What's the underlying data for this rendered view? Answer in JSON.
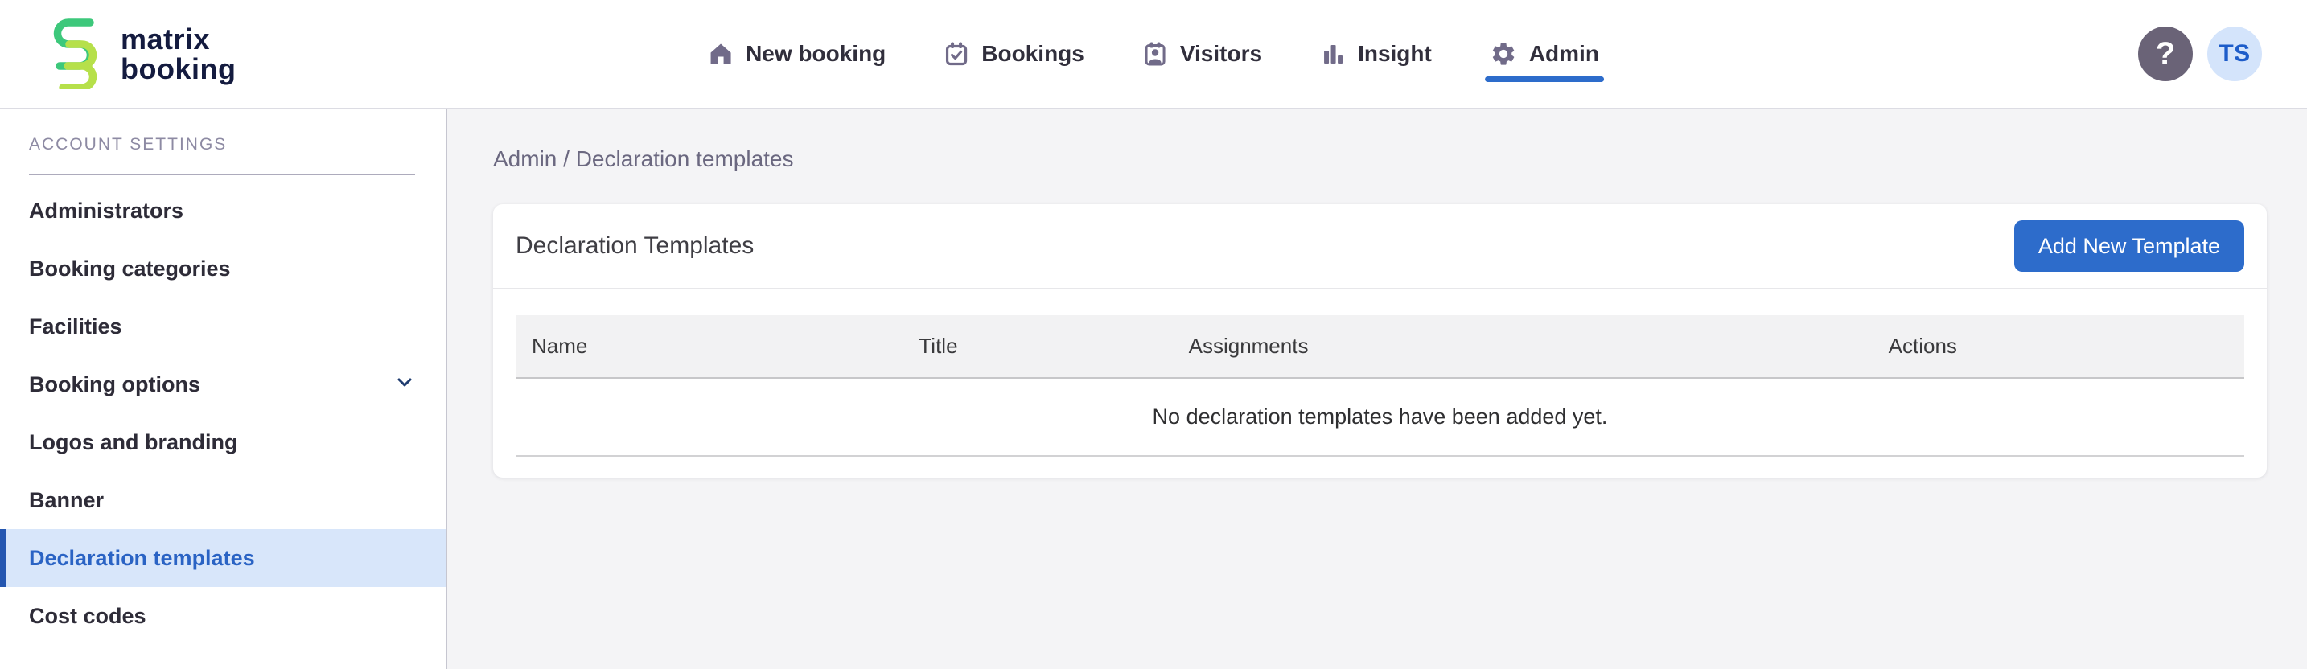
{
  "brand": {
    "name_line1": "matrix",
    "name_line2": "booking"
  },
  "topnav": {
    "items": [
      {
        "label": "New booking",
        "icon": "home-icon",
        "active": false
      },
      {
        "label": "Bookings",
        "icon": "calendar-check-icon",
        "active": false
      },
      {
        "label": "Visitors",
        "icon": "visitor-badge-icon",
        "active": false
      },
      {
        "label": "Insight",
        "icon": "bar-chart-icon",
        "active": false
      },
      {
        "label": "Admin",
        "icon": "gear-icon",
        "active": true
      }
    ]
  },
  "user": {
    "help_label": "?",
    "avatar_initials": "TS"
  },
  "sidebar": {
    "section_title": "ACCOUNT SETTINGS",
    "items": [
      {
        "label": "Administrators",
        "active": false
      },
      {
        "label": "Booking categories",
        "active": false
      },
      {
        "label": "Facilities",
        "active": false
      },
      {
        "label": "Booking options",
        "active": false,
        "has_chevron": true
      },
      {
        "label": "Logos and branding",
        "active": false
      },
      {
        "label": "Banner",
        "active": false
      },
      {
        "label": "Declaration templates",
        "active": true
      },
      {
        "label": "Cost codes",
        "active": false
      }
    ]
  },
  "breadcrumb": {
    "text": "Admin / Declaration templates"
  },
  "main": {
    "card": {
      "title": "Declaration Templates",
      "add_button_label": "Add New Template",
      "table": {
        "columns": [
          "Name",
          "Title",
          "Assignments",
          "Actions"
        ],
        "rows": [],
        "empty_message": "No declaration templates have been added yet."
      }
    }
  },
  "colors": {
    "primary_blue": "#2d6ccb",
    "active_item_bg": "#d8e6fa",
    "active_item_text": "#2a63c4",
    "active_item_border": "#2456b0",
    "avatar_bg": "#d4e4fb",
    "avatar_text": "#1d5cc9",
    "help_bg": "#6a6377",
    "logo_green": "#3dc87b",
    "logo_lime": "#b6e04a",
    "nav_icon": "#716b89"
  }
}
